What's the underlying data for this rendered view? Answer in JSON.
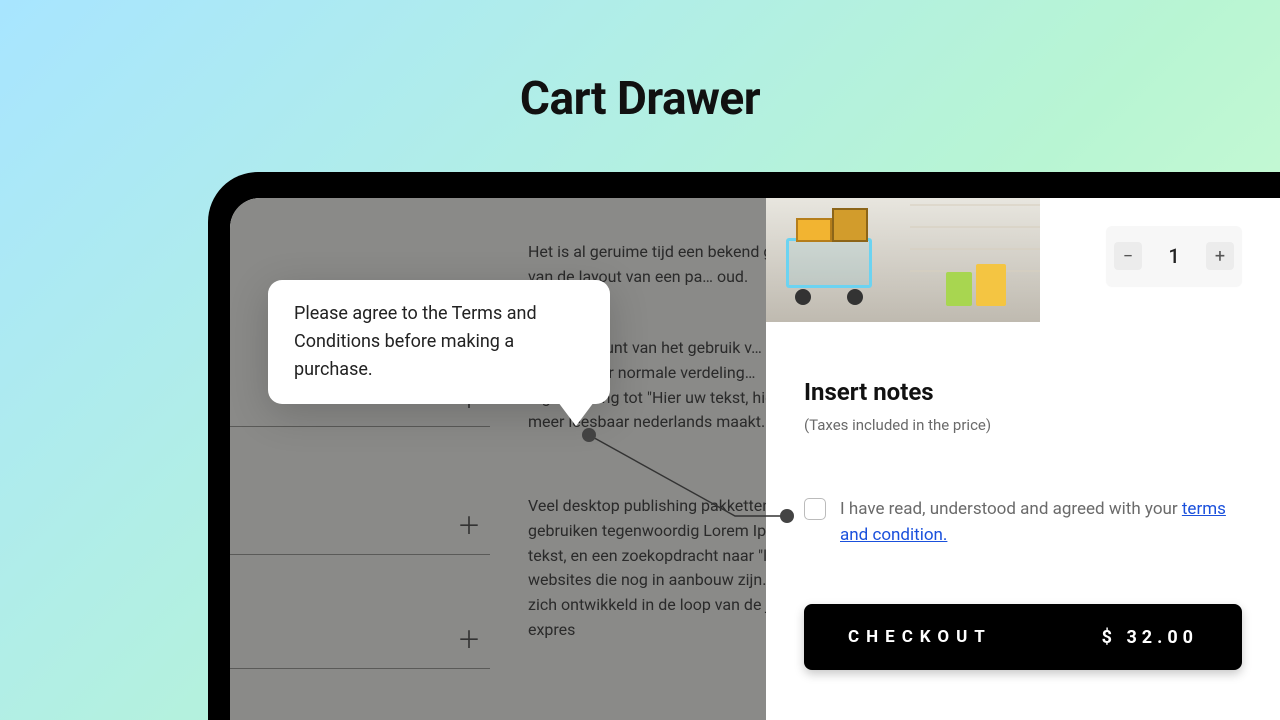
{
  "title": "Cart Drawer",
  "tooltip": {
    "message": "Please agree to the Terms and Conditions before making a purchase."
  },
  "background_text": {
    "p1": "Het is al geruime tijd een bekend gegev… van de layout van een pa… oud.",
    "p2": "He… rijke punt van het gebruik v… uit een min of meer normale verdeling… tegenstelling tot \"Hier uw tekst, hier u… meer leesbaar nederlands maakt.",
    "p3": "Veel desktop publishing pakketten en… gebruiken tegenwoordig Lorem Ipsum… tekst, en een zoekopdracht naar \"loren… websites die nog in aanbouw zijn. Ver… zich ontwikkeld in de loop van de jare… expres"
  },
  "drawer": {
    "quantity": 1,
    "notes_heading": "Insert notes",
    "notes_sub": "(Taxes included in the price)",
    "terms_prefix": "I have read, understood and agreed with your ",
    "terms_link": "terms and condition.",
    "checkout_label": "CHECKOUT",
    "checkout_price": "$ 32.00"
  }
}
